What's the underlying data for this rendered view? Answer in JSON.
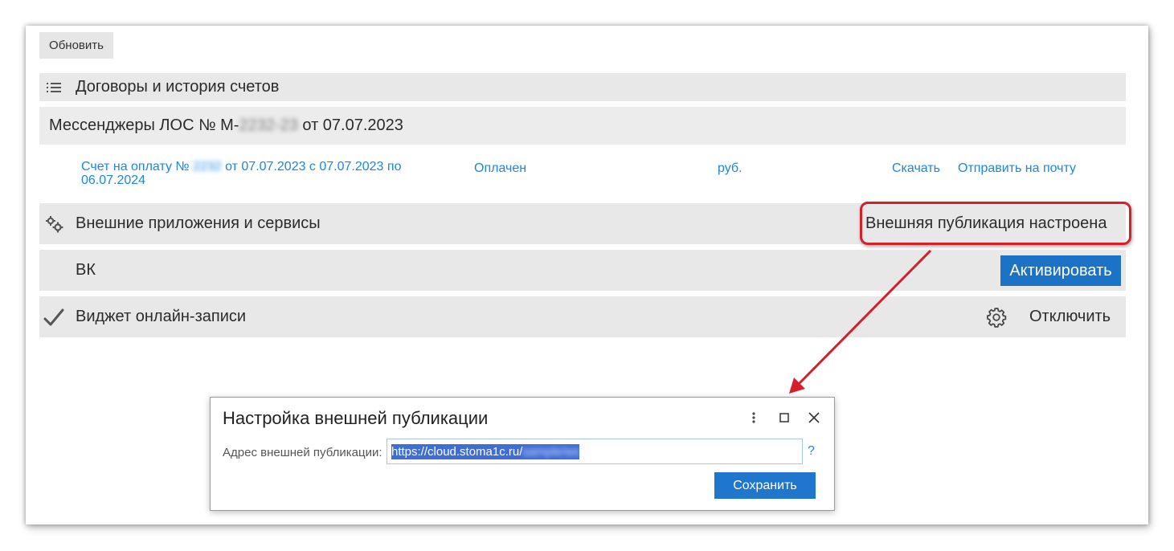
{
  "toolbar": {
    "refresh_label": "Обновить"
  },
  "contracts": {
    "header": "Договоры и история счетов",
    "contract": {
      "prefix": "Мессенджеры ЛОС № М-",
      "number_masked": "2232-23",
      "suffix": " от 07.07.2023"
    },
    "invoice": {
      "prefix": "Счет на оплату № ",
      "number_masked": "2232",
      "suffix": " от 07.07.2023 с 07.07.2023 по 06.07.2024",
      "status": "Оплачен",
      "currency": "руб.",
      "download_label": "Скачать",
      "email_label": "Отправить на почту"
    }
  },
  "services": {
    "header": "Внешние приложения и сервисы",
    "publication_status": "Внешняя публикация настроена",
    "vk": {
      "label": "ВК",
      "activate_label": "Активировать"
    },
    "widget": {
      "label": "Виджет онлайн-записи",
      "disable_label": "Отключить"
    }
  },
  "dialog": {
    "title": "Настройка внешней публикации",
    "address_label": "Адрес внешней публикации:",
    "address_value": "https://cloud.stoma1c.ru/",
    "address_masked": "sample/ws",
    "help": "?",
    "save_label": "Сохранить"
  },
  "colors": {
    "accent": "#1c72c4",
    "link": "#1b87e0",
    "highlight": "#d3202a",
    "band": "#e8e8e8"
  }
}
